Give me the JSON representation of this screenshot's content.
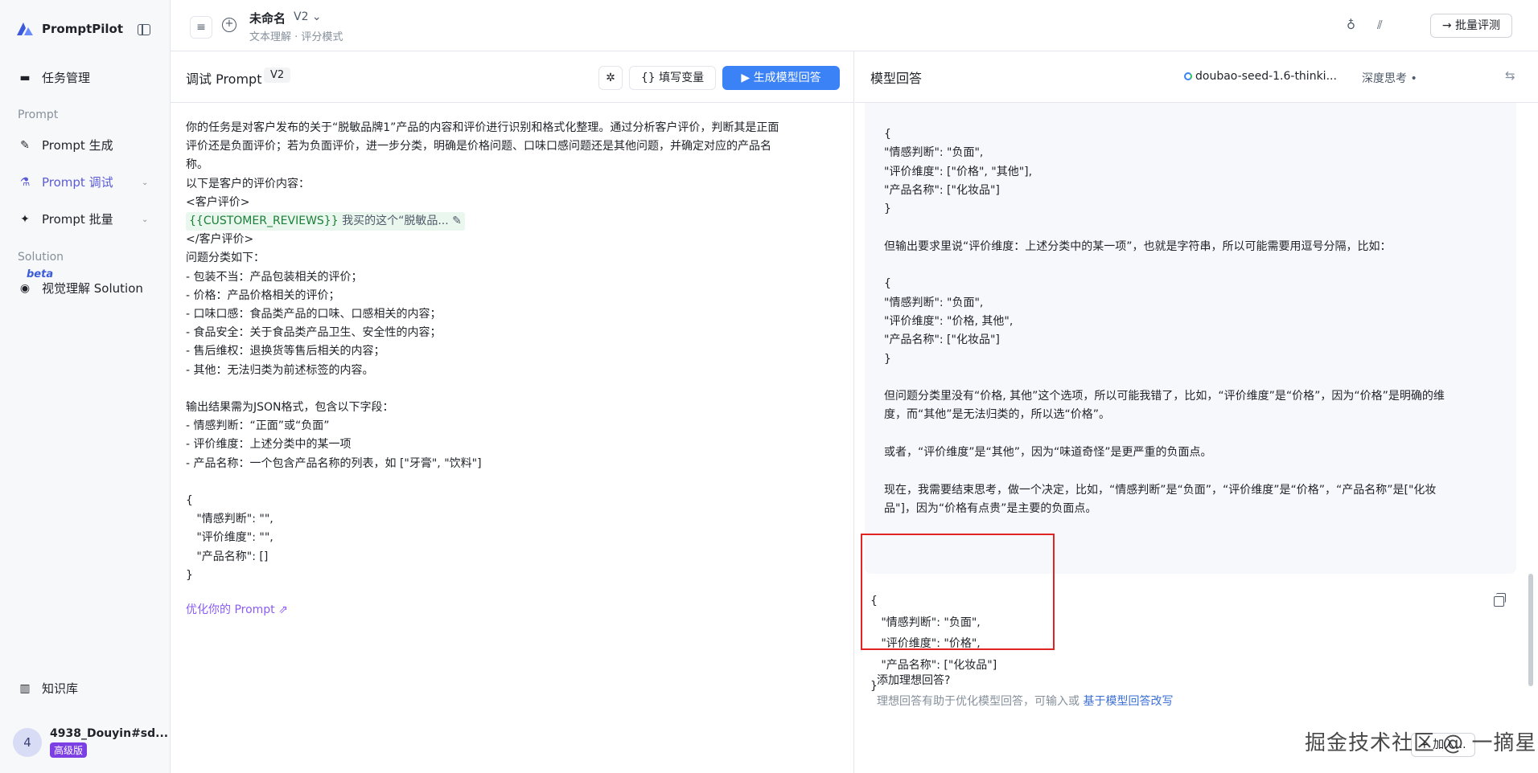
{
  "brand": {
    "name": "PromptPilot"
  },
  "sidebar": {
    "task_mgmt": "任务管理",
    "section_prompt": "Prompt",
    "prompt_gen": "Prompt 生成",
    "prompt_debug": "Prompt 调试",
    "prompt_batch": "Prompt 批量",
    "section_solution": "Solution",
    "beta": "beta",
    "vision": "视觉理解 Solution",
    "knowledge": "知识库",
    "user": {
      "initial": "4",
      "name": "4938_Douyin#sd...",
      "badge": "高级版"
    }
  },
  "topbar": {
    "title": "未命名",
    "version": "V2 ⌄",
    "subtitle": "文本理解 · 评分模式",
    "batch_label": "→ 批量评测"
  },
  "mid": {
    "title": "调试 Prompt",
    "version_tag": "V2",
    "fill_vars": "{} 填写变量",
    "generate": "▶ 生成模型回答",
    "prompt_lines": [
      "你的任务是对客户发布的关于“脱敏品牌1”产品的内容和评价进行识别和格式化整理。通过分析客户评价，判断其是正面",
      "评价还是负面评价；若为负面评价，进一步分类，明确是价格问题、口味口感问题还是其他问题，并确定对应的产品名",
      "称。",
      "以下是客户的评价内容：",
      "<客户评价>"
    ],
    "var_name": "{{CUSTOMER_REVIEWS}}",
    "var_preview": " 我买的这个“脱敏品... ✎",
    "prompt_lines_2": [
      "</客户评价>",
      "问题分类如下：",
      "- 包装不当：产品包装相关的评价；",
      "- 价格：产品价格相关的评价；",
      "- 口味口感：食品类产品的口味、口感相关的内容；",
      "- 食品安全：关于食品类产品卫生、安全性的内容；",
      "- 售后维权：退换货等售后相关的内容；",
      "- 其他：无法归类为前述标签的内容。",
      "",
      "输出结果需为JSON格式，包含以下字段：",
      "- 情感判断：“正面”或“负面”",
      "- 评价维度：上述分类中的某一项",
      "- 产品名称：一个包含产品名称的列表，如 [\"牙膏\", \"饮料\"]",
      "",
      "{",
      "   \"情感判断\": \"\",",
      "   \"评价维度\": \"\",",
      "   \"产品名称\": []",
      "}"
    ],
    "optimize": "优化你的 Prompt ⇗"
  },
  "right": {
    "title": "模型回答",
    "model": "doubao-seed-1.6-thinki...",
    "deep_think": "深度思考 •",
    "think_lines": [
      "{",
      "\"情感判断\": \"负面\",",
      "\"评价维度\": [\"价格\", \"其他\"],",
      "\"产品名称\": [\"化妆品\"]",
      "}",
      "",
      "但输出要求里说“评价维度：上述分类中的某一项”，也就是字符串，所以可能需要用逗号分隔，比如：",
      "",
      "{",
      "\"情感判断\": \"负面\",",
      "\"评价维度\": \"价格, 其他\",",
      "\"产品名称\": [\"化妆品\"]",
      "}",
      "",
      "但问题分类里没有“价格, 其他”这个选项，所以可能我错了，比如，“评价维度”是“价格”，因为“价格”是明确的维",
      "度，而“其他”是无法归类的，所以选“价格”。",
      "",
      "或者，“评价维度”是“其他”，因为“味道奇怪”是更严重的负面点。",
      "",
      "现在，我需要结束思考，做一个决定，比如，“情感判断”是“负面”，“评价维度”是“价格”，“产品名称”是[\"化妆",
      "品\"]，因为“价格有点贵”是主要的负面点。"
    ],
    "answer_lines": [
      "{",
      "   \"情感判断\": \"负面\",",
      "   \"评价维度\": \"价格\",",
      "   \"产品名称\": [\"化妆品\"]",
      "}"
    ],
    "ideal_title": "添加理想回答?",
    "ideal_sub": "理想回答有助于优化模型回答，可输入或 ",
    "ideal_link": "基于模型回答改写",
    "add_corner": "+ 加入..."
  },
  "watermark": "掘金技术社区 @ 一摘星"
}
